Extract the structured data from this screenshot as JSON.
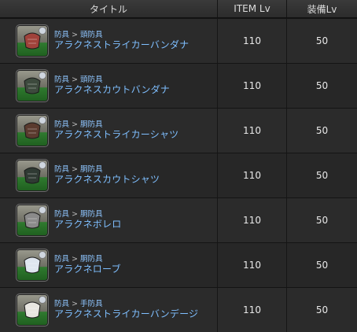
{
  "header": {
    "title_col": "タイトル",
    "item_lv_col": "ITEM Lv",
    "equip_lv_col": "装備Lv"
  },
  "rows": [
    {
      "category": "防具",
      "subcategory": "頭防具",
      "name": "アラクネストライカーバンダナ",
      "item_lv": "110",
      "equip_lv": "50",
      "icon": "bandana-icon",
      "icon_color": "#a0423a"
    },
    {
      "category": "防具",
      "subcategory": "頭防具",
      "name": "アラクネスカウトバンダナ",
      "item_lv": "110",
      "equip_lv": "50",
      "icon": "bandana-icon",
      "icon_color": "#3d4a3d"
    },
    {
      "category": "防具",
      "subcategory": "胴防具",
      "name": "アラクネストライカーシャツ",
      "item_lv": "110",
      "equip_lv": "50",
      "icon": "shirt-icon",
      "icon_color": "#5a3a2e"
    },
    {
      "category": "防具",
      "subcategory": "胴防具",
      "name": "アラクネスカウトシャツ",
      "item_lv": "110",
      "equip_lv": "50",
      "icon": "shirt-icon",
      "icon_color": "#2f3a33"
    },
    {
      "category": "防具",
      "subcategory": "胴防具",
      "name": "アラクネボレロ",
      "item_lv": "110",
      "equip_lv": "50",
      "icon": "bolero-icon",
      "icon_color": "#8a8a8a"
    },
    {
      "category": "防具",
      "subcategory": "胴防具",
      "name": "アラクネローブ",
      "item_lv": "110",
      "equip_lv": "50",
      "icon": "robe-icon",
      "icon_color": "#dfe6ef"
    },
    {
      "category": "防具",
      "subcategory": "手防具",
      "name": "アラクネストライカーバンデージ",
      "item_lv": "110",
      "equip_lv": "50",
      "icon": "bandage-icon",
      "icon_color": "#e8e6e0"
    }
  ],
  "separator": ">"
}
